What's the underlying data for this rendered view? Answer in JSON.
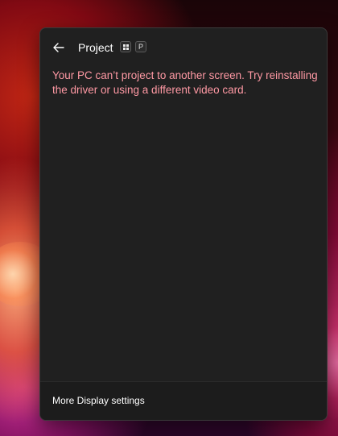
{
  "flyout": {
    "title": "Project",
    "shortcut_keys": {
      "win_key_icon": "windows-logo",
      "letter_key": "P"
    },
    "back_icon": "arrow-left",
    "error_message": "Your PC can’t project to another screen. Try reinstalling the driver or using a different video card.",
    "footer_link": "More Display settings"
  },
  "colors": {
    "panel_background": "#202020",
    "footer_background": "#1c1c1c",
    "error_text": "#ff99a4",
    "primary_text": "#ffffff"
  }
}
